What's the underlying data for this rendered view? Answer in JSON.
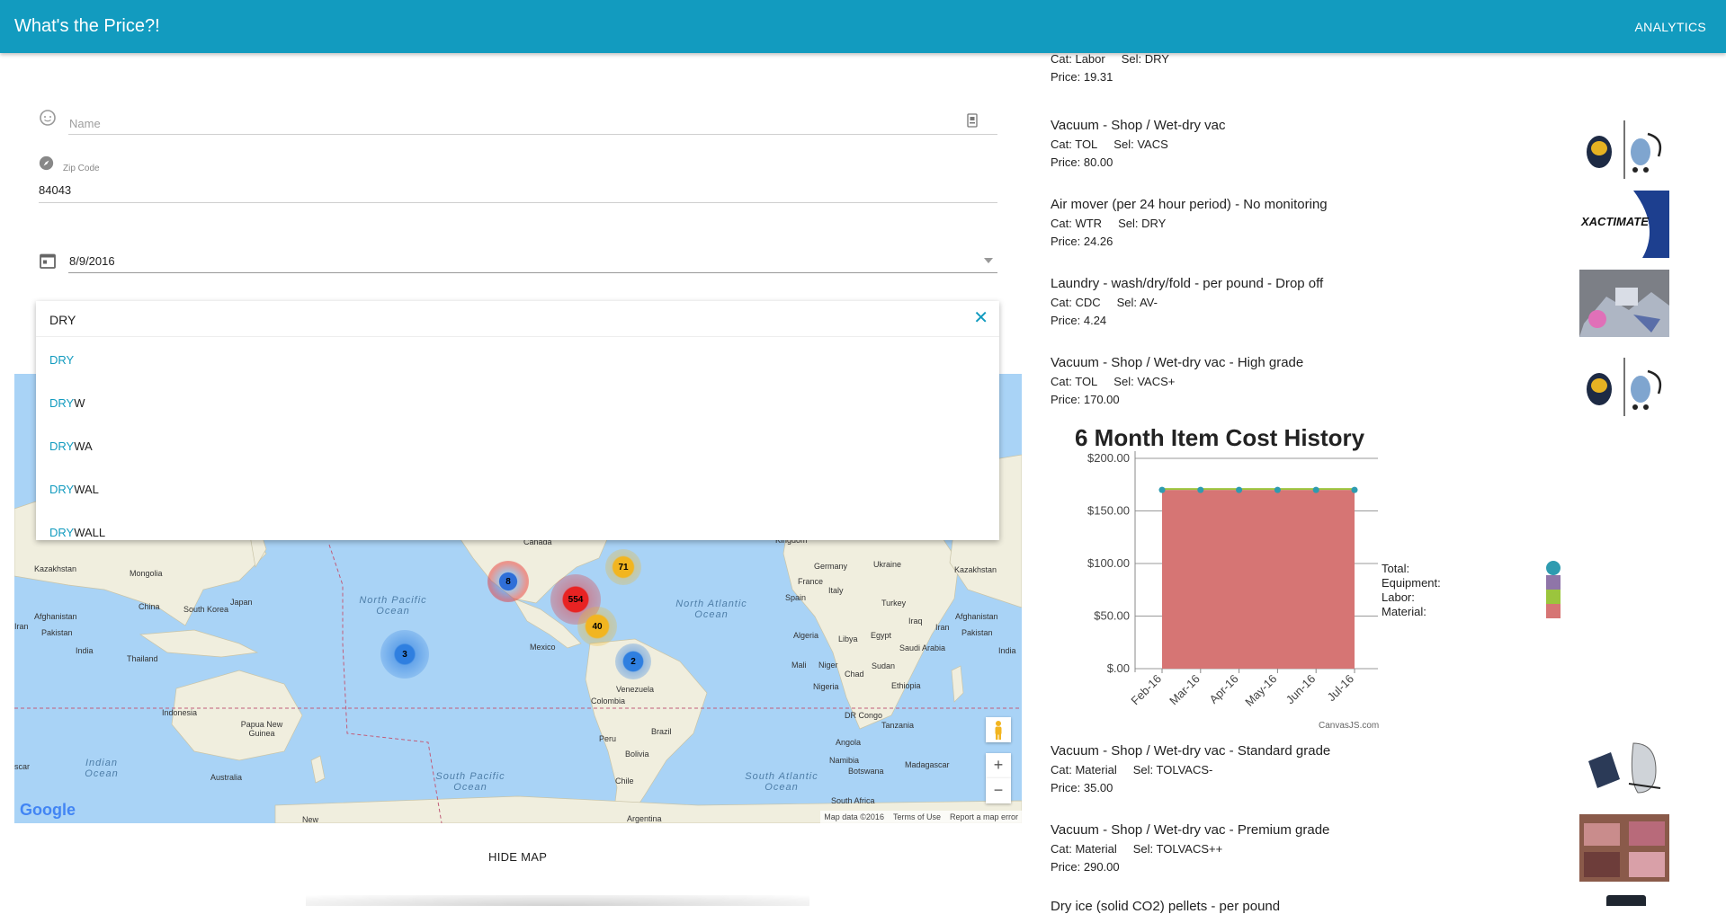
{
  "app": {
    "title": "What's the Price?!",
    "nav_analytics": "ANALYTICS"
  },
  "form": {
    "name_placeholder": "Name",
    "zip_label": "Zip Code",
    "zip_value": "84043",
    "date_value": "8/9/2016"
  },
  "autocomplete": {
    "query": "DRY",
    "clear_icon": "close-icon",
    "options": [
      {
        "match": "DRY",
        "rest": ""
      },
      {
        "match": "DRY",
        "rest": "W"
      },
      {
        "match": "DRY",
        "rest": "WA"
      },
      {
        "match": "DRY",
        "rest": "WAL"
      },
      {
        "match": "DRY",
        "rest": "WALL"
      }
    ]
  },
  "map": {
    "countries": [
      "Canada",
      "Kazakhstan",
      "Mongolia",
      "China",
      "South Korea",
      "Japan",
      "Afghanistan",
      "Pakistan",
      "India",
      "Thailand",
      "Iran",
      "Indonesia",
      "Papua New Guinea",
      "Australia",
      "Mexico",
      "Venezuela",
      "Colombia",
      "Peru",
      "Brazil",
      "Bolivia",
      "Chile",
      "Argentina",
      "Germany",
      "Ukraine",
      "France",
      "Spain",
      "Italy",
      "Turkey",
      "Iraq",
      "Algeria",
      "Libya",
      "Egypt",
      "Saudi Arabia",
      "Mali",
      "Niger",
      "Chad",
      "Sudan",
      "Nigeria",
      "Ethiopia",
      "DR Congo",
      "Tanzania",
      "Angola",
      "Namibia",
      "Botswana",
      "South Africa",
      "Madagascar",
      "Kingdom",
      "Kazakhstan",
      "Afghanistan",
      "Pakistan",
      "India",
      "Iran",
      "New"
    ],
    "oceans": [
      "North Pacific Ocean",
      "North Atlantic Ocean",
      "South Pacific Ocean",
      "South Atlantic Ocean",
      "Indian Ocean"
    ],
    "clusters": [
      {
        "count": "8",
        "color": "#2f6fd8"
      },
      {
        "count": "554",
        "color": "#e82323"
      },
      {
        "count": "71",
        "color": "#f2b520"
      },
      {
        "count": "40",
        "color": "#f2b520"
      },
      {
        "count": "3",
        "color": "#2f7fe0"
      },
      {
        "count": "2",
        "color": "#2f7fe0"
      }
    ],
    "footer": [
      "Map data ©2016",
      "Terms of Use",
      "Report a map error"
    ],
    "logo": "Google",
    "left_partial_label": "scar",
    "hide_map_label": "HIDE MAP"
  },
  "items_top": [
    {
      "name": "",
      "cat": "Labor",
      "sel": "DRY",
      "price": "19.31"
    },
    {
      "name": "Vacuum - Shop / Wet-dry vac",
      "cat": "TOL",
      "sel": "VACS",
      "price": "80.00",
      "thumb": "vacuum-image"
    },
    {
      "name": "Air mover (per 24 hour period) - No monitoring",
      "cat": "WTR",
      "sel": "DRY",
      "price": "24.26",
      "thumb": "xactimate-logo"
    },
    {
      "name": "Laundry - wash/dry/fold - per pound - Drop off",
      "cat": "CDC",
      "sel": "AV-",
      "price": "4.24",
      "thumb": "laundry-image"
    },
    {
      "name": "Vacuum - Shop / Wet-dry vac - High grade",
      "cat": "TOL",
      "sel": "VACS+",
      "price": "170.00",
      "thumb": "vacuum-image"
    }
  ],
  "items_bottom": [
    {
      "name": "Vacuum - Shop / Wet-dry vac - Standard grade",
      "cat": "Material",
      "sel": "TOLVACS-",
      "price": "35.00",
      "thumb": "vacuum-image"
    },
    {
      "name": "Vacuum - Shop / Wet-dry vac - Premium grade",
      "cat": "Material",
      "sel": "TOLVACS++",
      "price": "290.00",
      "thumb": "furniture-image"
    },
    {
      "name": "Dry ice (solid CO2) pellets - per pound",
      "cat": "",
      "sel": "",
      "price": "",
      "thumb": "dark-image"
    }
  ],
  "labels": {
    "cat": "Cat:",
    "sel": "Sel:",
    "price": "Price:",
    "xactimate": "XACTIMATE"
  },
  "chart_data": {
    "type": "area",
    "title": "6 Month Item Cost History",
    "categories": [
      "Feb-16",
      "Mar-16",
      "Apr-16",
      "May-16",
      "Jun-16",
      "Jul-16"
    ],
    "ylim": [
      0,
      200
    ],
    "yticks": [
      "$.00",
      "$50.00",
      "$100.00",
      "$150.00",
      "$200.00"
    ],
    "ytick_values": [
      0,
      50,
      100,
      150,
      200
    ],
    "series": [
      {
        "name": "Total:",
        "values": [
          170,
          170,
          170,
          170,
          170,
          170
        ],
        "color": "#2e9bb0"
      },
      {
        "name": "Equipment:",
        "values": [
          0,
          0,
          0,
          0,
          0,
          0
        ],
        "color": "#8f75a8"
      },
      {
        "name": "Labor:",
        "values": [
          0,
          0,
          0,
          0,
          0,
          0
        ],
        "color": "#9bc53d"
      },
      {
        "name": "Material:",
        "values": [
          170,
          170,
          170,
          170,
          170,
          170
        ],
        "color": "#d67574"
      }
    ],
    "legend": "right",
    "grid": true,
    "credit": "CanvasJS.com"
  }
}
